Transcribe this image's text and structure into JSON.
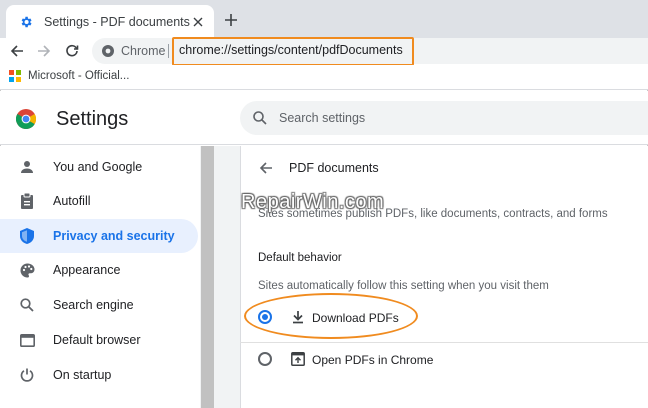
{
  "browser": {
    "tab_title": "Settings - PDF documents",
    "new_tab_symbol": "+",
    "site_chip": "Chrome",
    "url": "chrome://settings/content/pdfDocuments",
    "bookmark_label": "Microsoft - Official..."
  },
  "colors": {
    "accent": "#1a73e8",
    "highlight": "#f08b1f",
    "active_bg": "#e8f0fe"
  },
  "settings": {
    "title": "Settings",
    "search_placeholder": "Search settings"
  },
  "sidebar": {
    "items": [
      {
        "label": "You and Google",
        "icon": "person-icon"
      },
      {
        "label": "Autofill",
        "icon": "clipboard-icon"
      },
      {
        "label": "Privacy and security",
        "icon": "shield-icon",
        "active": true
      },
      {
        "label": "Appearance",
        "icon": "palette-icon"
      },
      {
        "label": "Search engine",
        "icon": "search-icon"
      },
      {
        "label": "Default browser",
        "icon": "browser-window-icon"
      },
      {
        "label": "On startup",
        "icon": "power-icon"
      }
    ]
  },
  "page": {
    "title": "PDF documents",
    "description": "Sites sometimes publish PDFs, like documents, contracts, and forms",
    "section_heading": "Default behavior",
    "section_sub": "Sites automatically follow this setting when you visit them",
    "options": [
      {
        "label": "Download PDFs",
        "icon": "download-icon",
        "checked": true
      },
      {
        "label": "Open PDFs in Chrome",
        "icon": "open-in-new-icon",
        "checked": false
      }
    ]
  },
  "watermark": "RepairWin.com"
}
